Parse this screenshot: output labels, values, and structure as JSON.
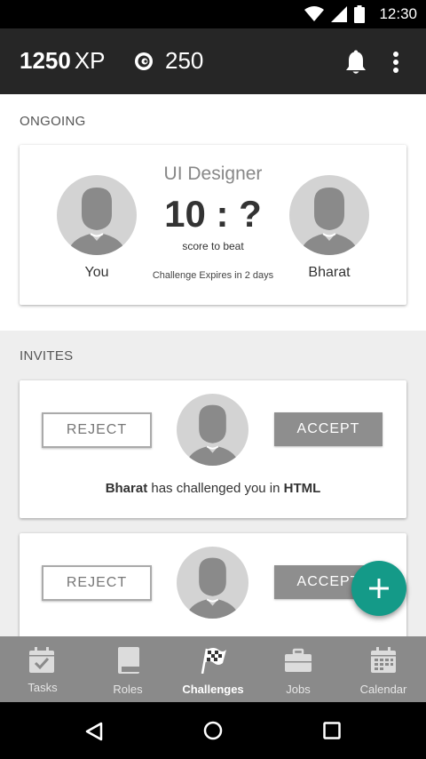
{
  "status_bar": {
    "time": "12:30"
  },
  "app_bar": {
    "xp_value": "1250",
    "xp_unit": "XP",
    "coins": "250"
  },
  "ongoing": {
    "section_title": "ONGOING",
    "role": "UI Designer",
    "score": "10 : ?",
    "score_caption": "score to beat",
    "left_name": "You",
    "right_name": "Bharat",
    "expires": "Challenge Expires in 2 days"
  },
  "invites": {
    "section_title": "INVITES",
    "cards": [
      {
        "reject_label": "REJECT",
        "accept_label": "ACCEPT",
        "challenger": "Bharat",
        "message": "has challenged you in",
        "topic": "HTML"
      },
      {
        "reject_label": "REJECT",
        "accept_label": "ACCEPT"
      }
    ]
  },
  "fab": {
    "icon": "plus-icon"
  },
  "bottom_nav": {
    "items": [
      {
        "label": "Tasks",
        "icon": "calendar-check-icon"
      },
      {
        "label": "Roles",
        "icon": "book-icon"
      },
      {
        "label": "Challenges",
        "icon": "checkered-flag-icon",
        "active": true
      },
      {
        "label": "Jobs",
        "icon": "briefcase-icon"
      },
      {
        "label": "Calendar",
        "icon": "calendar-icon"
      }
    ]
  },
  "colors": {
    "app_bar": "#262626",
    "fab": "#149a88",
    "bottom_nav": "#8a8a8a",
    "accept_button": "#8e8e8e"
  }
}
